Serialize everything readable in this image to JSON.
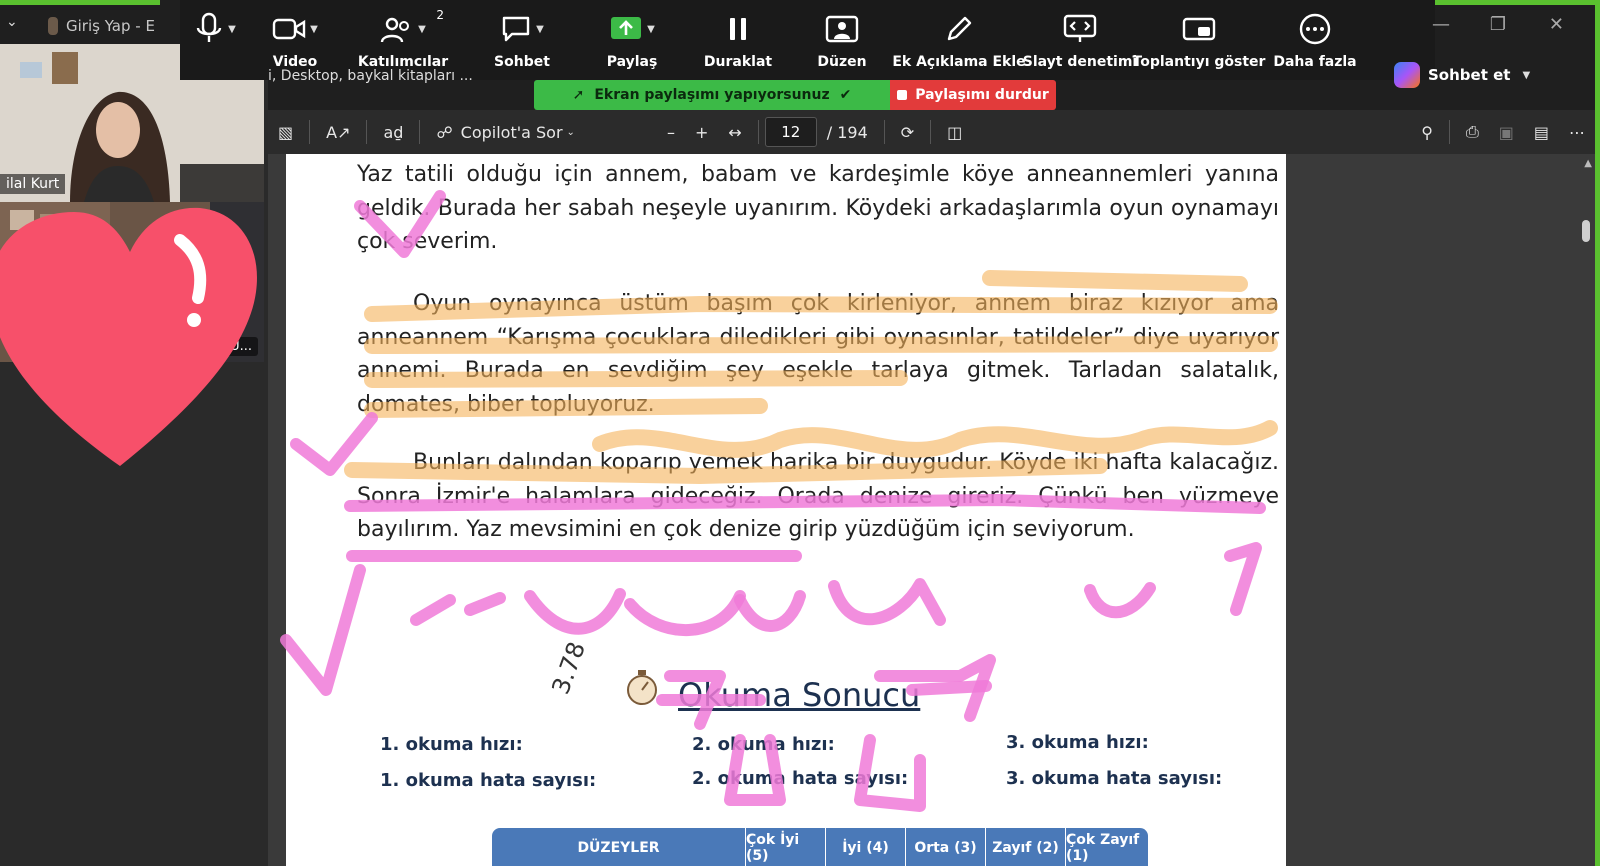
{
  "tab": {
    "title": "Giriş Yap - E"
  },
  "path_fragment": "i, Desktop, baykal kitapları ...",
  "toolbar": {
    "participants_count": "2",
    "items": [
      {
        "id": "mic",
        "label": ""
      },
      {
        "id": "video",
        "label": "Video"
      },
      {
        "id": "participants",
        "label": "Katılımcılar"
      },
      {
        "id": "chat",
        "label": "Sohbet"
      },
      {
        "id": "share",
        "label": "Paylaş"
      },
      {
        "id": "pause",
        "label": "Duraklat"
      },
      {
        "id": "layout",
        "label": "Düzen"
      },
      {
        "id": "annotate",
        "label": "Ek Açıklama Ekle"
      },
      {
        "id": "slide",
        "label": "Slayt denetimi"
      },
      {
        "id": "showmeeting",
        "label": "Toplantıyı göster"
      },
      {
        "id": "more",
        "label": "Daha fazla"
      }
    ]
  },
  "copilot_chat": "Sohbet et",
  "share_banner": {
    "status": "Ekran paylaşımı yapıyorsunuz",
    "stop": "Paylaşımı durdur"
  },
  "pdf": {
    "ask_copilot": "Copilot'a Sor",
    "page_current": "12",
    "page_total": "/ 194",
    "zoom_minus": "–",
    "zoom_plus": "+"
  },
  "participants": [
    {
      "name": "ilal Kurt"
    },
    {
      "name": "TU..."
    }
  ],
  "document": {
    "paragraphs": [
      "Yaz tatili olduğu için annem, babam ve kardeşimle köye anneannemleri yanına geldik. Burada her sabah neşeyle uyanırım. Köydeki arkadaşlarımla oyun oynamayı çok severim.",
      "Oyun oynayınca üstüm başım çok kirleniyor, annem biraz kızıyor ama anneannem “Karışma çocuklara diledikleri gibi oynasınlar, tatildeler” diye uyarıyor annemi. Burada en sevdiğim şey eşekle tarlaya gitmek. Tarladan salatalık, domates, biber topluyoruz.",
      "Bunları dalından koparıp yemek harika bir duygudur. Köyde iki hafta kalacağız. Sonra İzmir'e halamlara gideceğiz. Orada denize gireriz. Çünkü ben yüzmeye bayılırım. Yaz mevsimini en çok denize girip yüzdüğüm için seviyorum."
    ],
    "result_title": "Okuma Sonucu",
    "metrics": [
      "1. okuma hızı:",
      "2. okuma hızı:",
      "3. okuma hızı:",
      "1. okuma hata sayısı:",
      "2. okuma hata sayısı:",
      "3. okuma hata sayısı:"
    ],
    "levels": [
      "DÜZEYLER",
      "Çok İyi (5)",
      "İyi (4)",
      "Orta (3)",
      "Zayıf (2)",
      "Çok Zayıf (1)"
    ],
    "handwritten_note": "3.78"
  },
  "colors": {
    "share_green": "#3cba47",
    "stop_red": "#e23b3b",
    "highlight_orange": "#f5b25a",
    "pen_pink": "#f07ad8",
    "heart": "#f7506a"
  }
}
